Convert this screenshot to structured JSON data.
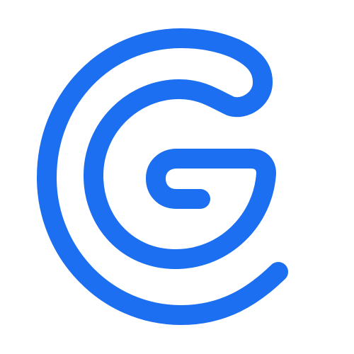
{
  "logo": {
    "icon": "stylized-g-spiral-logo",
    "stroke_color": "#1c6ff0",
    "background_color": "#ffffff"
  }
}
